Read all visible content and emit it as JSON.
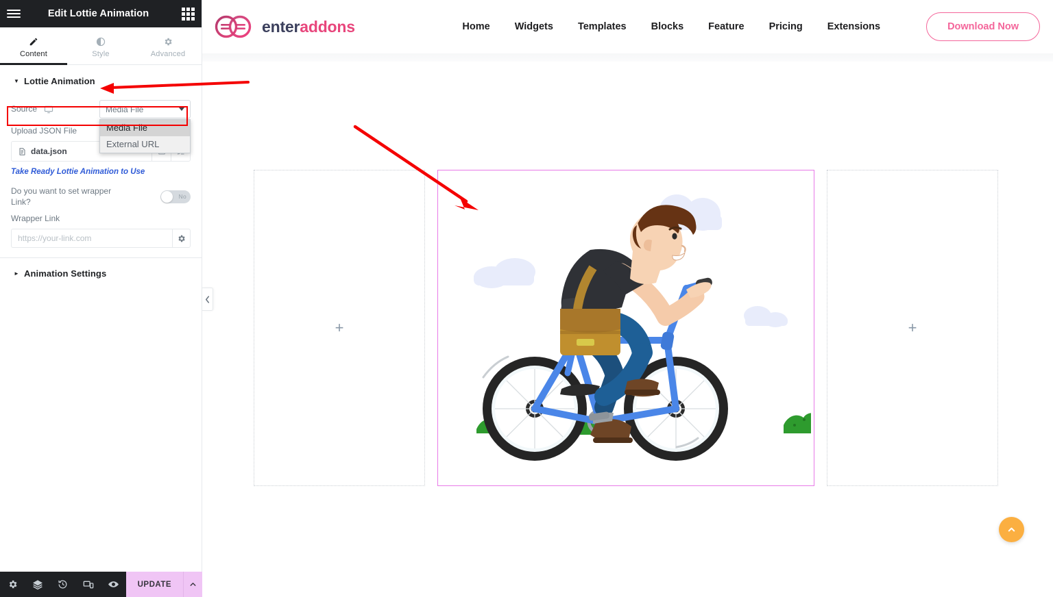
{
  "panel": {
    "header": {
      "title": "Edit Lottie Animation",
      "menu_icon": "hamburger-icon",
      "apps_icon": "apps-grid-icon"
    },
    "tabs": [
      {
        "label": "Content",
        "icon": "pencil-icon",
        "active": true
      },
      {
        "label": "Style",
        "icon": "contrast-icon",
        "active": false
      },
      {
        "label": "Advanced",
        "icon": "gear-icon",
        "active": false
      }
    ],
    "sections": [
      {
        "title": "Lottie Animation",
        "expanded": true
      },
      {
        "title": "Animation Settings",
        "expanded": false
      }
    ],
    "controls": {
      "source": {
        "label": "Source",
        "device_icon": "desktop-icon",
        "value": "Media File",
        "options": [
          "Media File",
          "External URL"
        ],
        "open": true,
        "selected_index": 0
      },
      "upload_json": {
        "label": "Upload JSON File",
        "file_name": "data.json",
        "file_icon": "document-icon",
        "actions": [
          "media-library-button",
          "edit-button"
        ]
      },
      "helper_link": "Take Ready Lottie Animation to Use",
      "wrapper_toggle": {
        "label": "Do you want to set wrapper Link?",
        "state": "No",
        "on": false
      },
      "wrapper_link": {
        "label": "Wrapper Link",
        "value": "",
        "placeholder": "https://your-link.com",
        "settings_icon": "gear-icon"
      }
    },
    "footer": {
      "icons": [
        "settings-gear-icon",
        "navigator-layers-icon",
        "history-clock-icon",
        "responsive-mode-icon",
        "preview-eye-icon"
      ],
      "update_label": "UPDATE",
      "update_caret_icon": "chevron-up-icon"
    },
    "collapse_tab_icon": "chevron-left-icon"
  },
  "preview": {
    "site": {
      "brand": {
        "name_part1": "enter",
        "name_part2": "addons",
        "logo_icon": "interlocking-circles-logo"
      },
      "nav": [
        {
          "label": "Home"
        },
        {
          "label": "Widgets"
        },
        {
          "label": "Templates"
        },
        {
          "label": "Blocks"
        },
        {
          "label": "Feature"
        },
        {
          "label": "Pricing"
        },
        {
          "label": "Extensions"
        }
      ],
      "cta": {
        "label": "Download Now"
      }
    },
    "columns": [
      {
        "type": "empty",
        "add_icon": "plus-icon"
      },
      {
        "type": "lottie",
        "selected": true,
        "content": "cyclist-lottie-animation"
      },
      {
        "type": "empty",
        "add_icon": "plus-icon"
      }
    ],
    "scroll_top_icon": "chevron-up-icon"
  },
  "annotations": [
    {
      "type": "arrow",
      "target": "lottie-animation-section-header",
      "color": "#f40000"
    },
    {
      "type": "box",
      "target": "source-control-row",
      "color": "#f40000"
    },
    {
      "type": "arrow",
      "target": "lottie-preview-widget",
      "color": "#f40000"
    }
  ],
  "colors": {
    "panel_dark": "#1f2124",
    "accent_pink": "#f4659a",
    "brand_magenta": "#e8467c",
    "annotation_red": "#f40000",
    "selected_outline": "#e879e8",
    "update_bg": "#f0c5f5",
    "scroll_top_bg": "#fbaf41"
  }
}
